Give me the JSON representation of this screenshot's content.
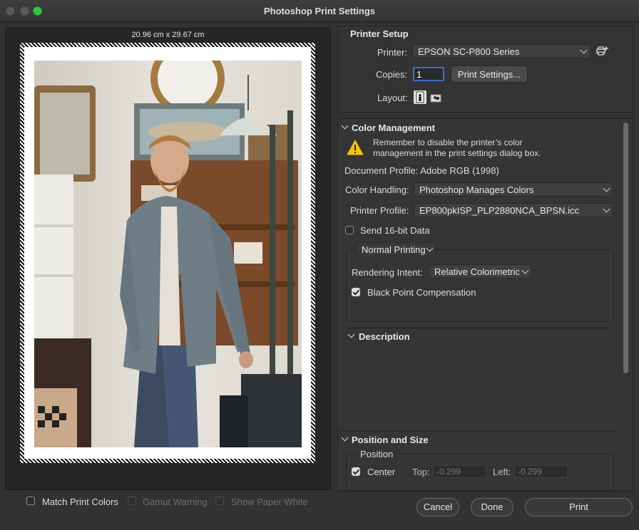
{
  "window": {
    "title": "Photoshop Print Settings"
  },
  "preview": {
    "paper_size": "20.96 cm x 29.67 cm"
  },
  "printer_setup": {
    "title": "Printer Setup",
    "printer_label": "Printer:",
    "printer_value": "EPSON SC-P800 Series",
    "copies_label": "Copies:",
    "copies_value": "1",
    "print_settings_button": "Print Settings...",
    "layout_label": "Layout:"
  },
  "color_management": {
    "title": "Color Management",
    "warning": "Remember to disable the printer’s color management in the print settings dialog box.",
    "document_profile": "Document Profile: Adobe RGB (1998)",
    "color_handling_label": "Color Handling:",
    "color_handling_value": "Photoshop Manages Colors",
    "printer_profile_label": "Printer Profile:",
    "printer_profile_value": "EP800pkISP_PLP2880NCA_BPSN.icc",
    "send_16bit_label": "Send 16-bit Data",
    "send_16bit_checked": false,
    "printing_mode_value": "Normal Printing",
    "rendering_intent_label": "Rendering Intent:",
    "rendering_intent_value": "Relative Colorimetric",
    "black_point_label": "Black Point Compensation",
    "black_point_checked": true
  },
  "description": {
    "title": "Description"
  },
  "position_size": {
    "title": "Position and Size",
    "position_label": "Position",
    "center_label": "Center",
    "center_checked": true,
    "top_label": "Top:",
    "top_value": "-0.299",
    "left_label": "Left:",
    "left_value": "-0.299"
  },
  "footer": {
    "match_print_colors": "Match Print Colors",
    "gamut_warning": "Gamut Warning",
    "show_paper_white": "Show Paper White",
    "cancel": "Cancel",
    "done": "Done",
    "print": "Print"
  },
  "colors": {
    "maximize": "#2dc840",
    "warning": "#f5c400"
  }
}
